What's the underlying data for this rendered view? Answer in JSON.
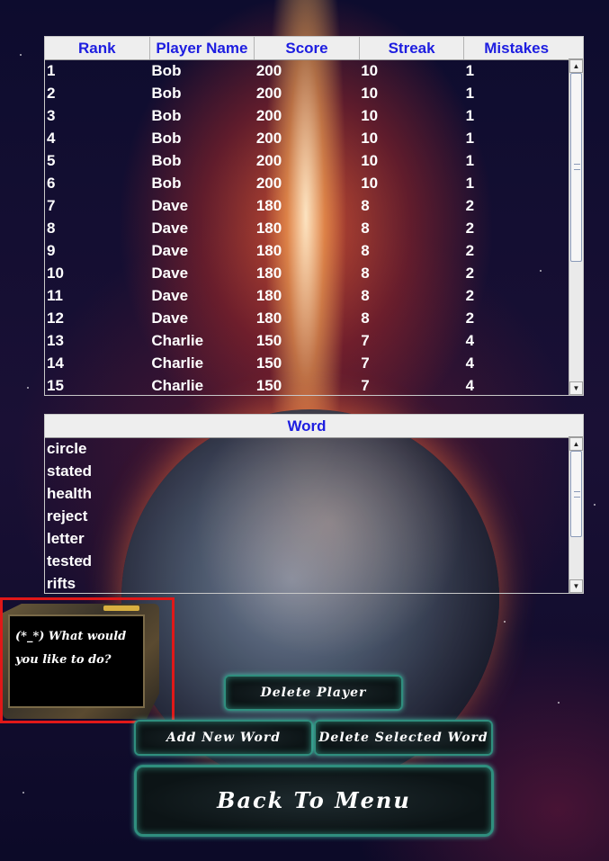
{
  "leaderboard": {
    "columns": [
      "Rank",
      "Player Name",
      "Score",
      "Streak",
      "Mistakes"
    ],
    "rows": [
      [
        "1",
        "Bob",
        "200",
        "10",
        "1"
      ],
      [
        "2",
        "Bob",
        "200",
        "10",
        "1"
      ],
      [
        "3",
        "Bob",
        "200",
        "10",
        "1"
      ],
      [
        "4",
        "Bob",
        "200",
        "10",
        "1"
      ],
      [
        "5",
        "Bob",
        "200",
        "10",
        "1"
      ],
      [
        "6",
        "Bob",
        "200",
        "10",
        "1"
      ],
      [
        "7",
        "Dave",
        "180",
        "8",
        "2"
      ],
      [
        "8",
        "Dave",
        "180",
        "8",
        "2"
      ],
      [
        "9",
        "Dave",
        "180",
        "8",
        "2"
      ],
      [
        "10",
        "Dave",
        "180",
        "8",
        "2"
      ],
      [
        "11",
        "Dave",
        "180",
        "8",
        "2"
      ],
      [
        "12",
        "Dave",
        "180",
        "8",
        "2"
      ],
      [
        "13",
        "Charlie",
        "150",
        "7",
        "4"
      ],
      [
        "14",
        "Charlie",
        "150",
        "7",
        "4"
      ],
      [
        "15",
        "Charlie",
        "150",
        "7",
        "4"
      ]
    ]
  },
  "word_list": {
    "column": "Word",
    "words": [
      "circle",
      "stated",
      "health",
      "reject",
      "letter",
      "tested",
      "rifts"
    ]
  },
  "dialog": {
    "message": "(*_*) What would you like to do?"
  },
  "buttons": {
    "delete_player": "Delete Player",
    "add_new_word": "Add New Word",
    "delete_selected_word": "Delete Selected Word",
    "back_to_menu": "Back To Menu"
  },
  "colors": {
    "header_text": "#1d1de0",
    "button_glow": "#2f8e7e",
    "dialog_highlight": "#e01818"
  }
}
